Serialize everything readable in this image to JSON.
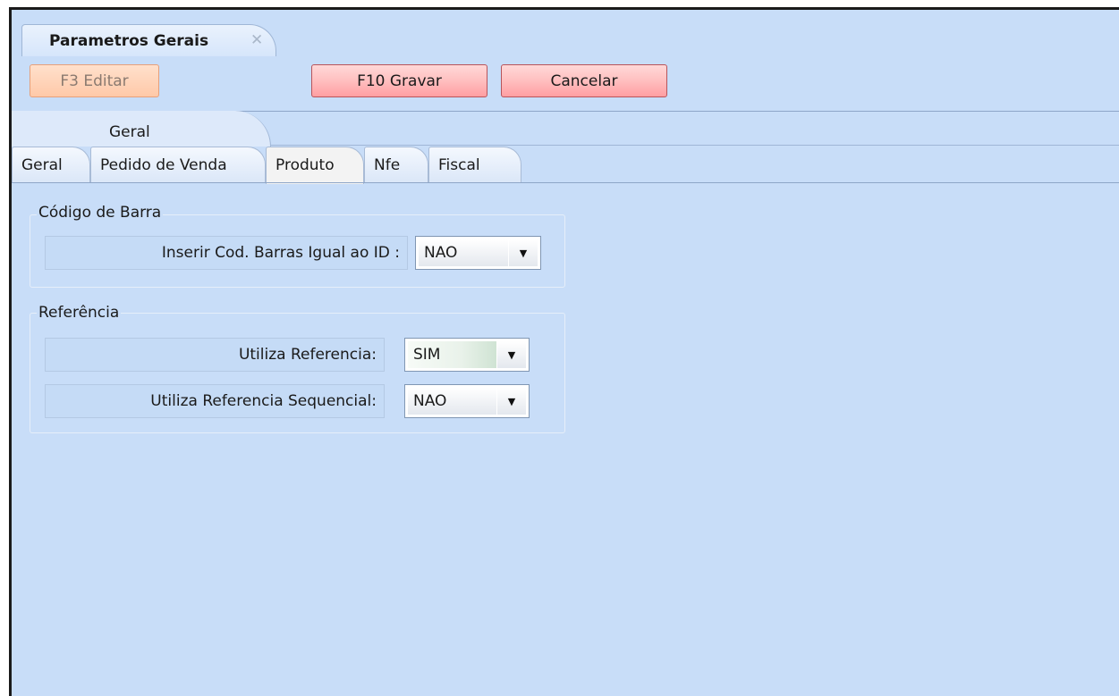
{
  "document_tab": {
    "title": "Parametros Gerais",
    "close_glyph": "✕"
  },
  "toolbar": {
    "edit_label": "F3 Editar",
    "save_label": "F10 Gravar",
    "cancel_label": "Cancelar"
  },
  "page_tab": {
    "label": "Geral"
  },
  "subtabs": [
    {
      "label": "Geral"
    },
    {
      "label": "Pedido de Venda"
    },
    {
      "label": "Produto"
    },
    {
      "label": "Nfe"
    },
    {
      "label": "Fiscal"
    }
  ],
  "groups": {
    "barcode": {
      "title": "Código de Barra",
      "fields": [
        {
          "label": "Inserir Cod. Barras Igual ao ID :",
          "value": "NAO"
        }
      ]
    },
    "reference": {
      "title": "Referência",
      "fields": [
        {
          "label": "Utiliza Referencia:",
          "value": "SIM"
        },
        {
          "label": "Utiliza Referencia Sequencial:",
          "value": "NAO"
        }
      ]
    }
  },
  "icons": {
    "dropdown": "chevron-down-icon",
    "close": "close-icon"
  },
  "colors": {
    "background": "#c8ddf8",
    "button": "#ffb4b4",
    "button_disabled": "#ffd6bf"
  }
}
